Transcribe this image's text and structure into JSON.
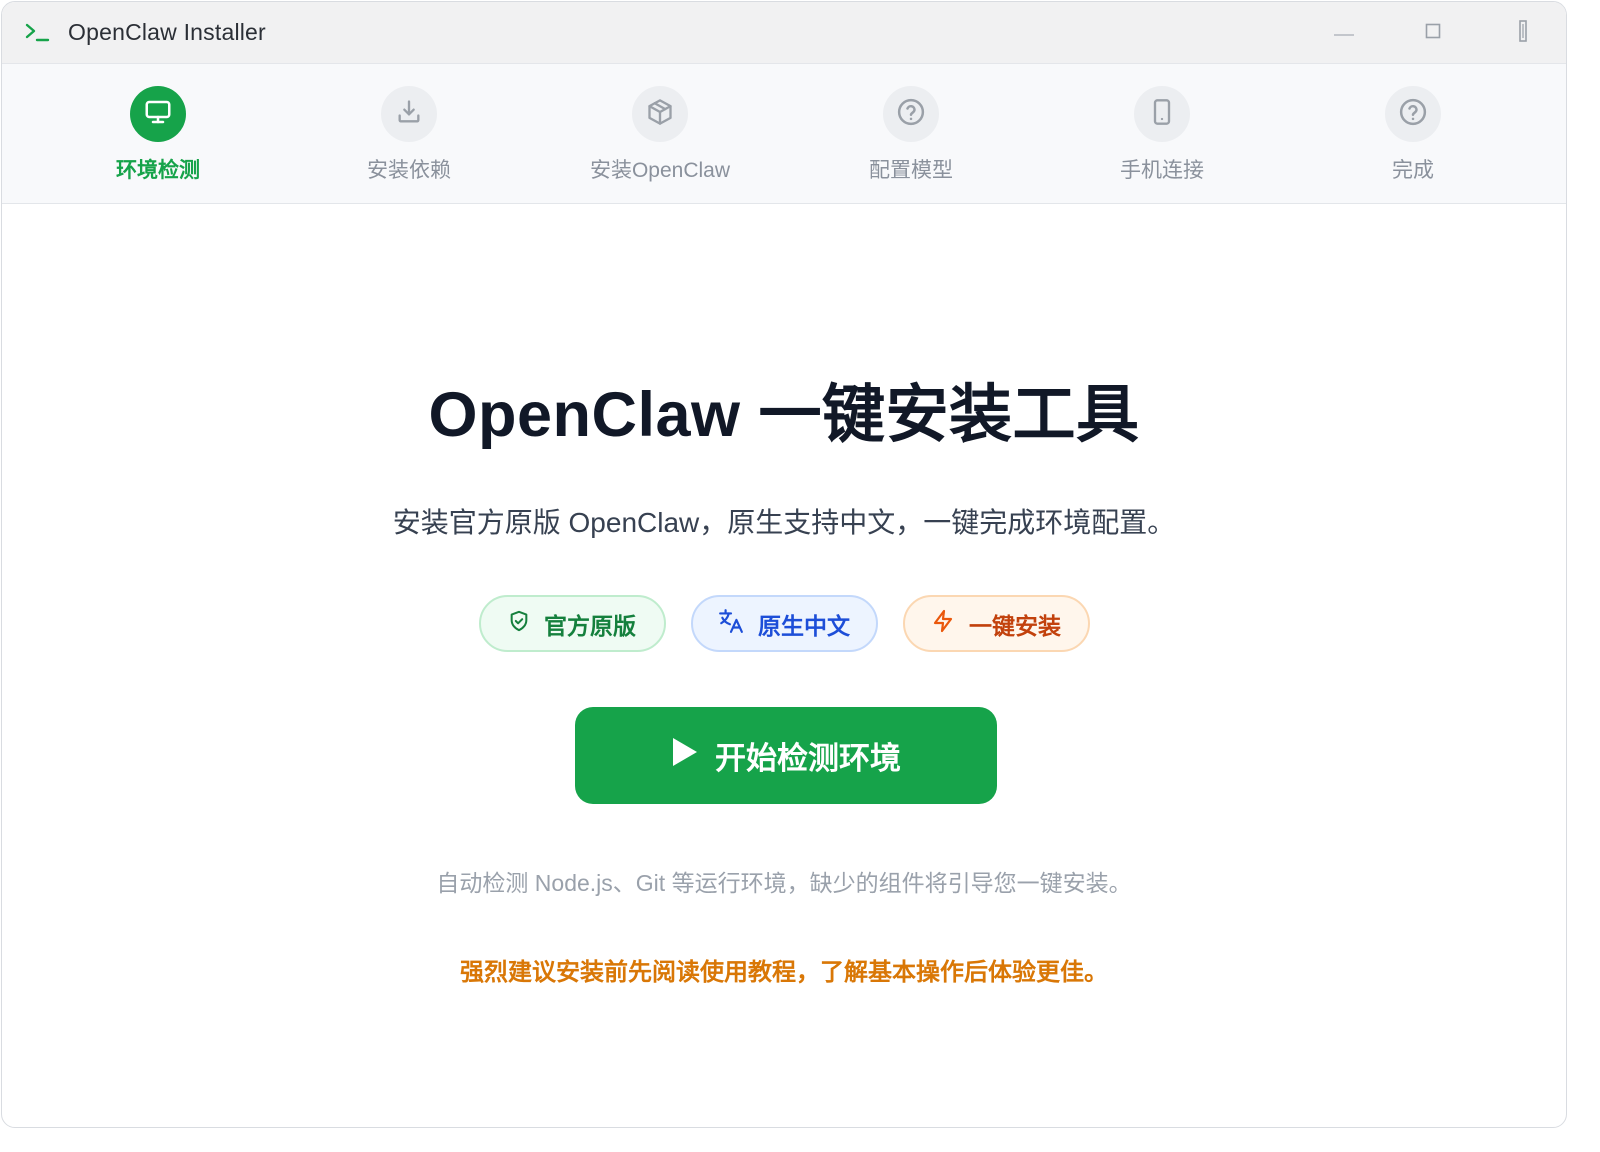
{
  "window": {
    "title": "OpenClaw Installer",
    "icon": "terminal-prompt-icon"
  },
  "titlebar_controls": {
    "minimize_icon": "minimize-icon",
    "maximize_icon": "maximize-icon",
    "close_icon": "close-icon"
  },
  "steps": [
    {
      "label": "环境检测",
      "icon": "monitor-icon",
      "active": true
    },
    {
      "label": "安装依赖",
      "icon": "download-icon",
      "active": false
    },
    {
      "label": "安装OpenClaw",
      "icon": "package-icon",
      "active": false
    },
    {
      "label": "配置模型",
      "icon": "help-circle-icon",
      "active": false
    },
    {
      "label": "手机连接",
      "icon": "smartphone-icon",
      "active": false
    },
    {
      "label": "完成",
      "icon": "help-circle-icon",
      "active": false
    }
  ],
  "main": {
    "headline": "OpenClaw 一键安装工具",
    "subtitle": "安装官方原版 OpenClaw，原生支持中文，一键完成环境配置。",
    "badges": [
      {
        "label": "官方原版",
        "icon": "shield-check-icon",
        "color": "#15803d"
      },
      {
        "label": "原生中文",
        "icon": "translate-icon",
        "color": "#1d4ed8"
      },
      {
        "label": "一键安装",
        "icon": "zap-icon",
        "color": "#c2410c"
      }
    ],
    "start_button": {
      "label": "开始检测环境",
      "icon": "play-icon"
    },
    "hint": "自动检测 Node.js、Git 等运行环境，缺少的组件将引导您一键安装。",
    "warning": "强烈建议安装前先阅读使用教程，了解基本操作后体验更佳。"
  },
  "colors": {
    "accent": "#16a34a",
    "warning": "#d97706"
  }
}
